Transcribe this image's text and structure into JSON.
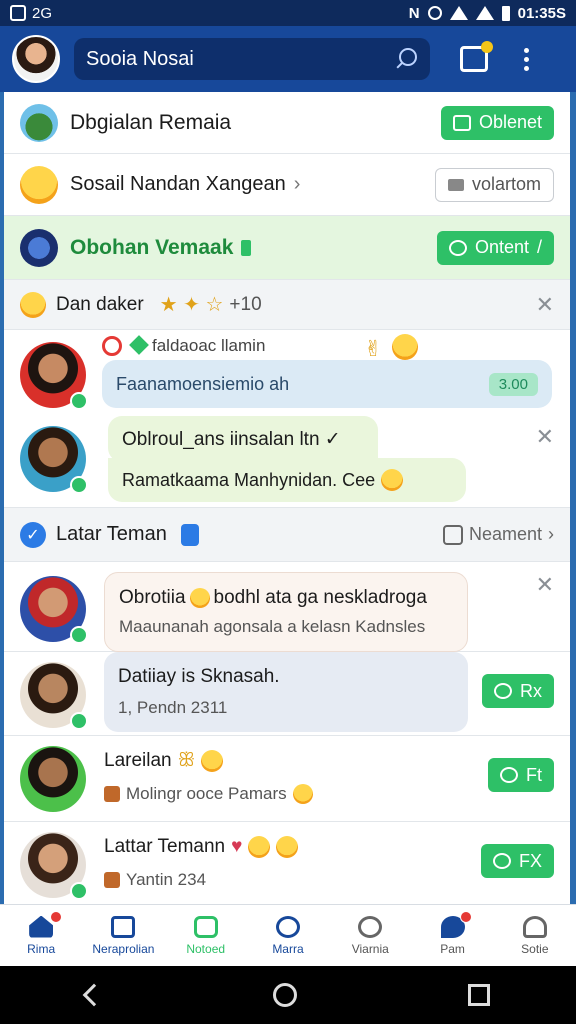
{
  "status_bar": {
    "left_text": "2G",
    "time": "01:35S",
    "icon_letter": "N"
  },
  "app_bar": {
    "search_value": "Sooia Nosai"
  },
  "items": [
    {
      "label": "Dbgialan Remaia",
      "button": "Oblenet"
    },
    {
      "label": "Sosail Nandan Xangean",
      "button": "volartom"
    },
    {
      "label": "Obohan Vemaak",
      "button": "Ontent"
    }
  ],
  "alert": {
    "label": "Dan daker",
    "count": "+10"
  },
  "chat1": {
    "sender": "faldaoac llamin",
    "bubble1": "Faanamoensiemio ah",
    "bubble1_badge": "3.00",
    "bubble2_title": "Oblroul_ans iinsalan ltn ✓",
    "bubble2_sub": "Ramatkaama Manhynidan. Cee"
  },
  "section": {
    "title": "Latar Teman",
    "link": "Neament"
  },
  "friends": [
    {
      "title": "Obrotiia",
      "title_rest": "bodhl ata ga neskladroga",
      "sub": "Maaunanah agonsala a kelasn Kadnsles"
    },
    {
      "title": "Datiiay is Sknasah.",
      "sub": "1, Pendn 2311",
      "button": "Rx"
    },
    {
      "title": "Lareilan",
      "sub": "Molingr ooce Pamars",
      "button": "Ft"
    },
    {
      "title": "Lattar Temann",
      "sub": "Yantin 234",
      "button": "FX"
    }
  ],
  "bottom_nav": [
    {
      "label": "Rima",
      "color": "#17489a"
    },
    {
      "label": "Neraprolian",
      "color": "#17489a"
    },
    {
      "label": "Notoed",
      "color": "#2ec067"
    },
    {
      "label": "Marra",
      "color": "#17489a"
    },
    {
      "label": "Viarnia",
      "color": "#555555"
    },
    {
      "label": "Pam",
      "color": "#555555"
    },
    {
      "label": "Sotie",
      "color": "#555555"
    }
  ],
  "colors": {
    "brand": "#17489a",
    "accent_green": "#2ec067",
    "highlight_green": "#e4f6df"
  }
}
